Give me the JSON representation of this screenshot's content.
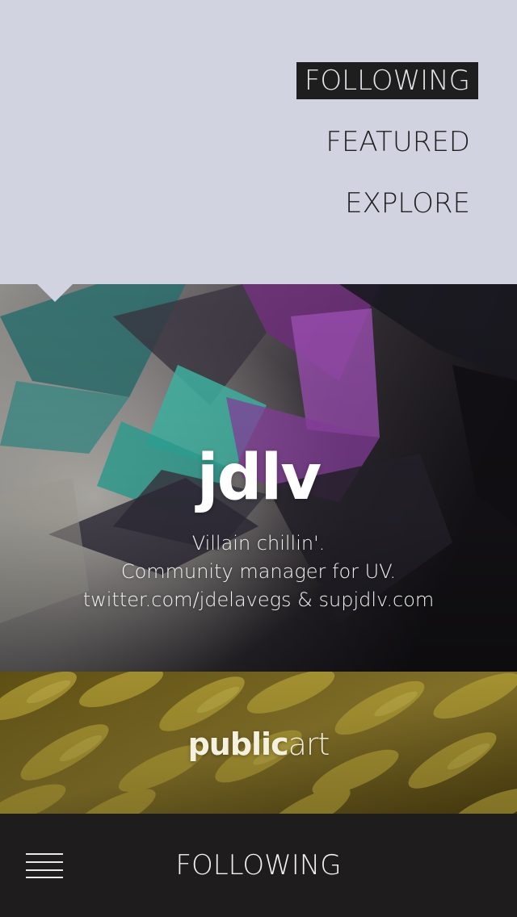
{
  "menu": {
    "items": [
      {
        "label": "FOLLOWING",
        "active": true
      },
      {
        "label": "FEATURED",
        "active": false
      },
      {
        "label": "EXPLORE",
        "active": false
      }
    ]
  },
  "profile": {
    "name": "jdlv",
    "bio": [
      "Villain chillin'.",
      "Community manager for UV.",
      "twitter.com/jdelavegs & supjdlv.com"
    ]
  },
  "collection": {
    "title_bold": "public",
    "title_light": "art"
  },
  "bottom_bar": {
    "title": "FOLLOWING",
    "menu_icon": "hamburger-menu-icon"
  },
  "colors": {
    "menu_background": "#d1d3e0",
    "active_highlight": "#1e1e1e",
    "bottom_bar": "#1e1c1c",
    "accent_teal": "#3fb7a6",
    "accent_purple": "#8a3fa0"
  }
}
